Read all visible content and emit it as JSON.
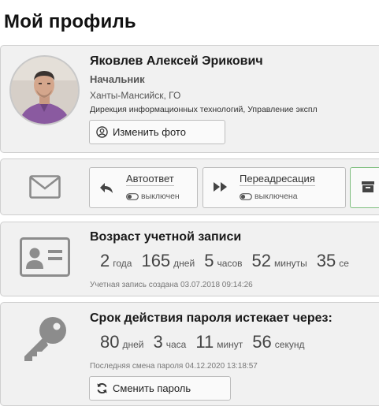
{
  "page": {
    "title": "Мой профиль"
  },
  "profile": {
    "name": "Яковлев Алексей Эрикович",
    "role": "Начальник",
    "location": "Ханты-Мансийск, ГО",
    "department": "Дирекция информационных технологий, Управление экспл",
    "change_photo_label": "Изменить фото"
  },
  "mail": {
    "icon": "envelope-icon",
    "autoreply": {
      "label": "Автоответ",
      "status": "выключен"
    },
    "forwarding": {
      "label": "Переадресация",
      "status": "выключена"
    },
    "archive_icon": "archive-icon"
  },
  "account_age": {
    "title": "Возраст учетной записи",
    "years": "2",
    "years_unit": "года",
    "days": "165",
    "days_unit": "дней",
    "hours": "5",
    "hours_unit": "часов",
    "minutes": "52",
    "minutes_unit": "минуты",
    "seconds": "35",
    "seconds_unit": "се",
    "created_note": "Учетная запись создана 03.07.2018 09:14:26"
  },
  "password": {
    "title": "Срок действия пароля истекает через:",
    "days": "80",
    "days_unit": "дней",
    "hours": "3",
    "hours_unit": "часа",
    "minutes": "11",
    "minutes_unit": "минут",
    "seconds": "56",
    "seconds_unit": "секунд",
    "changed_note": "Последняя смена пароля 04.12.2020 13:18:57",
    "change_label": "Сменить пароль"
  },
  "colors": {
    "card_bg": "#f1f1f1",
    "icon_gray": "#8c8c8c",
    "archive_border": "#7fbf7f"
  }
}
